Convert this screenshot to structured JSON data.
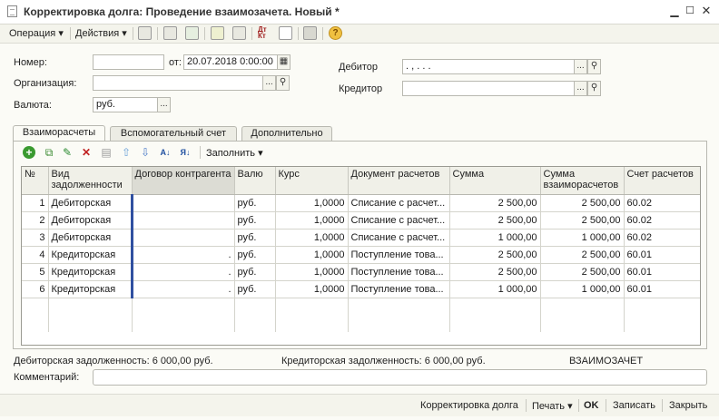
{
  "window": {
    "title": "Корректировка долга: Проведение взаимозачета. Новый *"
  },
  "toolbar": {
    "operation": "Операция",
    "actions": "Действия"
  },
  "form": {
    "number_label": "Номер:",
    "number_value": "",
    "date_label": "от:",
    "date_value": "20.07.2018  0:00:00",
    "org_label": "Организация:",
    "org_value": "",
    "currency_label": "Валюта:",
    "currency_value": "руб.",
    "debtor_label": "Дебитор",
    "debtor_value": ".      ,      .  .  .",
    "creditor_label": "Кредитор",
    "creditor_value": ""
  },
  "tabs": [
    "Взаиморасчеты",
    "Вспомогательный счет",
    "Дополнительно"
  ],
  "grid_toolbar": {
    "fill_label": "Заполнить"
  },
  "table": {
    "headers": [
      "№",
      "Вид задолженности",
      "Договор контрагента",
      "Валю",
      "Курс",
      "Документ расчетов",
      "Сумма",
      "Сумма взаиморасчетов",
      "Счет расчетов"
    ],
    "rows": [
      {
        "n": "1",
        "kind": "Дебиторская",
        "contract": "",
        "cur": "руб.",
        "rate": "1,0000",
        "doc": "Списание с расчет...",
        "sum": "2 500,00",
        "mutual": "2 500,00",
        "account": "60.02"
      },
      {
        "n": "2",
        "kind": "Дебиторская",
        "contract": "",
        "cur": "руб.",
        "rate": "1,0000",
        "doc": "Списание с расчет...",
        "sum": "2 500,00",
        "mutual": "2 500,00",
        "account": "60.02"
      },
      {
        "n": "3",
        "kind": "Дебиторская",
        "contract": "",
        "cur": "руб.",
        "rate": "1,0000",
        "doc": "Списание с расчет...",
        "sum": "1 000,00",
        "mutual": "1 000,00",
        "account": "60.02"
      },
      {
        "n": "4",
        "kind": "Кредиторская",
        "contract": ".",
        "cur": "руб.",
        "rate": "1,0000",
        "doc": "Поступление това...",
        "sum": "2 500,00",
        "mutual": "2 500,00",
        "account": "60.01"
      },
      {
        "n": "5",
        "kind": "Кредиторская",
        "contract": ".",
        "cur": "руб.",
        "rate": "1,0000",
        "doc": "Поступление това...",
        "sum": "2 500,00",
        "mutual": "2 500,00",
        "account": "60.01"
      },
      {
        "n": "6",
        "kind": "Кредиторская",
        "contract": ".",
        "cur": "руб.",
        "rate": "1,0000",
        "doc": "Поступление това...",
        "sum": "1 000,00",
        "mutual": "1 000,00",
        "account": "60.01"
      }
    ]
  },
  "totals": {
    "debit": "Дебиторская задолженность: 6 000,00 руб.",
    "credit": "Кредиторская задолженность: 6 000,00 руб.",
    "mode": "ВЗАИМОЗАЧЕТ"
  },
  "comment": {
    "label": "Комментарий:",
    "value": ""
  },
  "bottom": {
    "adjust": "Корректировка долга",
    "print": "Печать",
    "ok": "OK",
    "save": "Записать",
    "close": "Закрыть"
  }
}
